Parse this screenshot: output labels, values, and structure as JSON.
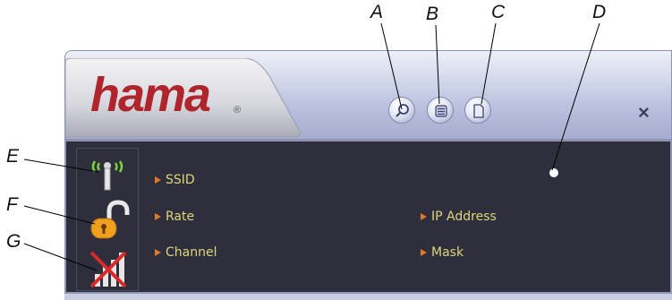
{
  "callouts": [
    "A",
    "B",
    "C",
    "D",
    "E",
    "F",
    "G"
  ],
  "logo": {
    "text": "hama",
    "reg": "®"
  },
  "toolbar": {
    "search_icon": "search-icon",
    "list_icon": "list-icon",
    "page_icon": "page-icon",
    "close_label": "×"
  },
  "info": {
    "ssid_label": "SSID",
    "rate_label": "Rate",
    "channel_label": "Channel",
    "ip_label": "IP Address",
    "mask_label": "Mask"
  },
  "colors": {
    "brand": "#b0242b",
    "panel": "#2e2e3c",
    "label": "#dcd67a",
    "bullet": "#e07a2a",
    "signal": "#7fd13a",
    "lock": "#f0a020",
    "no_signal": "#d92a2a"
  }
}
